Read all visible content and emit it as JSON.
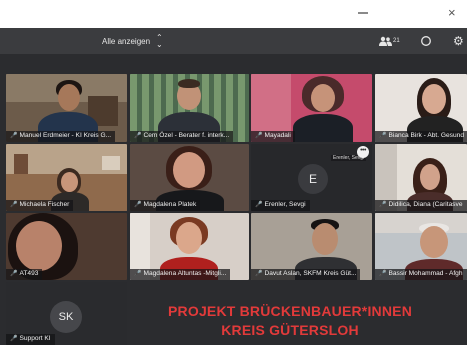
{
  "toolbar": {
    "view_selector_label": "Alle anzeigen",
    "participants_count": "21",
    "participants_icon": "people-icon",
    "chat_icon": "chat-icon",
    "settings_icon": "gear-icon"
  },
  "tiles": [
    {
      "name": "Manuel Erdmeier - KI Kreis G...",
      "mic": "on"
    },
    {
      "name": "Cem Özel - Berater f. interk...",
      "mic": "muted"
    },
    {
      "name": "Mayadali",
      "mic": "muted"
    },
    {
      "name": "Bianca Birk - Abt. Gesund",
      "mic": "muted"
    },
    {
      "name": "Michaela Fischer",
      "mic": "on"
    },
    {
      "name": "Magdalena Platek",
      "mic": "muted"
    },
    {
      "name": "Erenler, Sevgi",
      "mic": "muted"
    },
    {
      "name": "Didilica, Diana (Caritasve",
      "mic": "muted"
    },
    {
      "name": "AT493",
      "mic": "muted"
    },
    {
      "name": "Magdalena Altuntas -Mitgli...",
      "mic": "muted"
    },
    {
      "name": "Davut Aslan, SKFM Kreis Güt...",
      "mic": "muted"
    },
    {
      "name": "Bassir Mohammad - Afgh",
      "mic": "muted"
    },
    {
      "name": "Support KI",
      "mic": "muted"
    }
  ],
  "avatar_e": {
    "initial": "E",
    "label": "Erenler, Sevgi"
  },
  "avatar_sk": {
    "initials": "SK"
  },
  "banner": {
    "line1": "PROJEKT BRÜCKENBAUER*INNEN",
    "line2": "KREIS GÜTERSLOH"
  },
  "colors": {
    "banner_red": "#e23a3a",
    "toolbar": "#3b3c3f",
    "stage": "#2b2c2f",
    "mic_muted": "#e04848"
  }
}
